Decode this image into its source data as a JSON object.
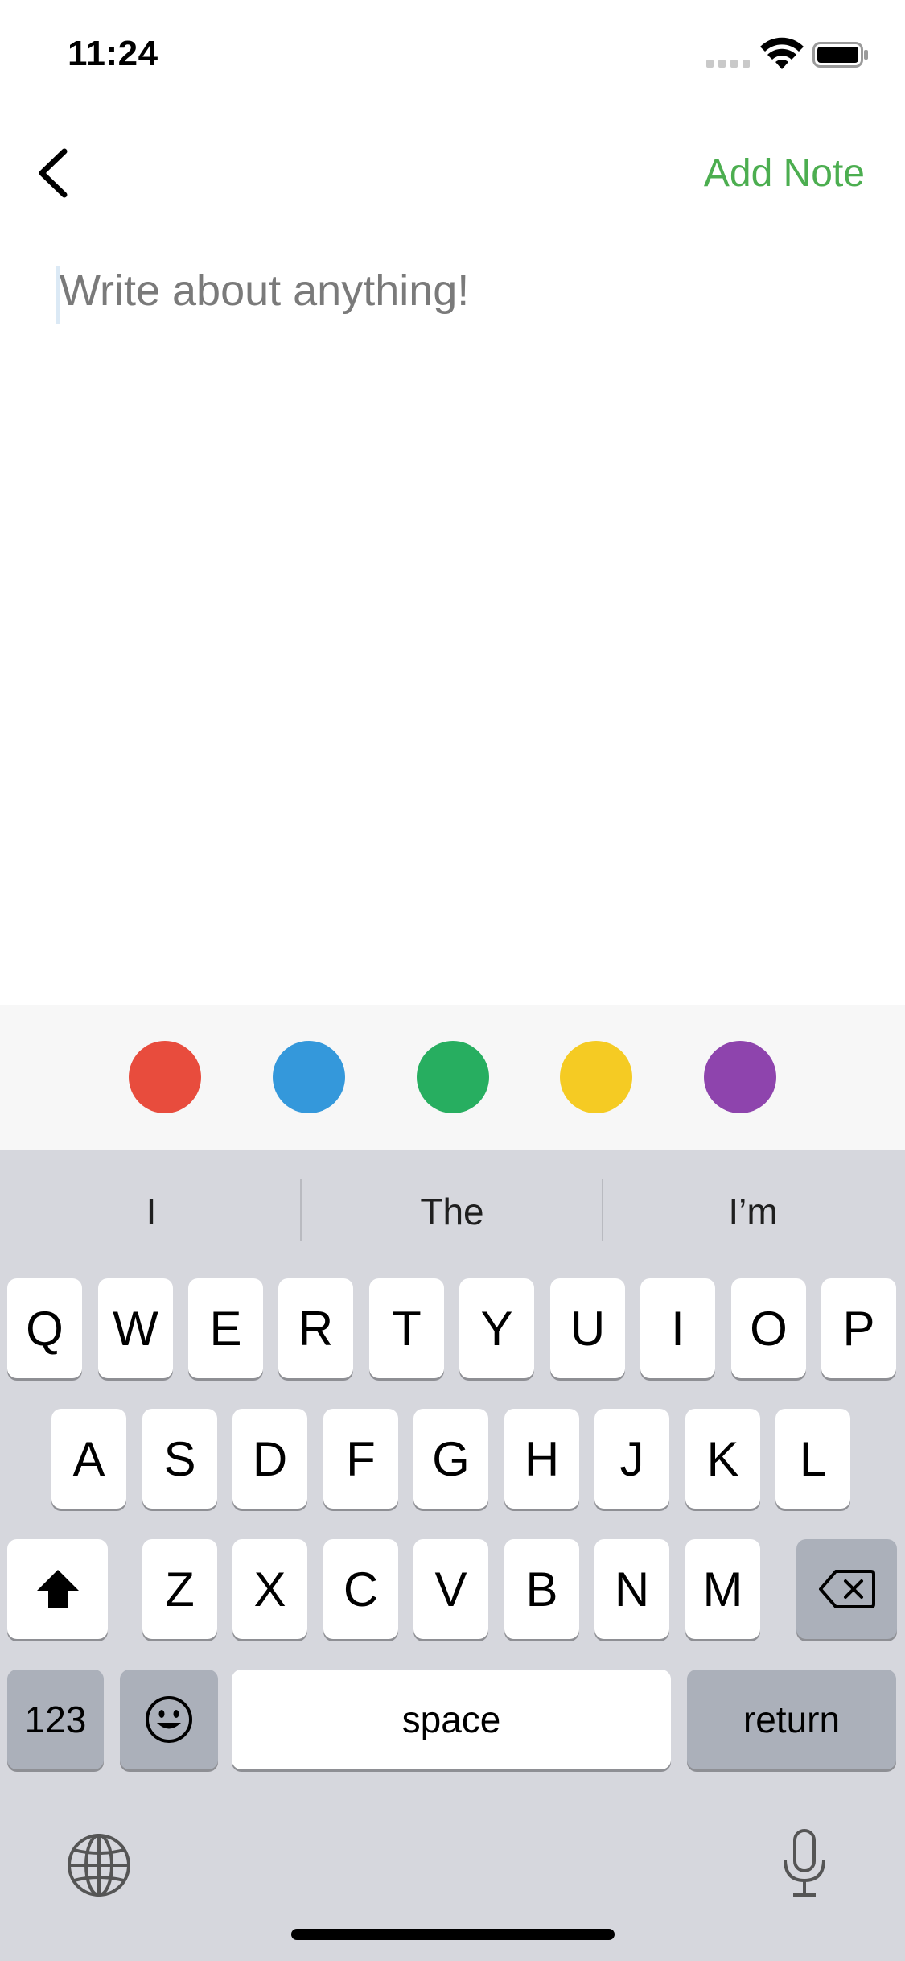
{
  "status": {
    "time": "11:24"
  },
  "nav": {
    "action_label": "Add Note"
  },
  "editor": {
    "placeholder": "Write about anything!",
    "value": ""
  },
  "colors": [
    {
      "name": "red",
      "hex": "#e84c3d"
    },
    {
      "name": "blue",
      "hex": "#3498db"
    },
    {
      "name": "green",
      "hex": "#27ae60"
    },
    {
      "name": "yellow",
      "hex": "#f5cb23"
    },
    {
      "name": "purple",
      "hex": "#8e44ad"
    }
  ],
  "accent_color": "#4cae50",
  "keyboard": {
    "suggestions": [
      "I",
      "The",
      "I’m"
    ],
    "row1": [
      "Q",
      "W",
      "E",
      "R",
      "T",
      "Y",
      "U",
      "I",
      "O",
      "P"
    ],
    "row2": [
      "A",
      "S",
      "D",
      "F",
      "G",
      "H",
      "J",
      "K",
      "L"
    ],
    "row3": [
      "Z",
      "X",
      "C",
      "V",
      "B",
      "N",
      "M"
    ],
    "numbers_label": "123",
    "space_label": "space",
    "return_label": "return",
    "icons": [
      "shift-icon",
      "delete-icon",
      "emoji-icon",
      "globe-icon",
      "microphone-icon"
    ]
  }
}
